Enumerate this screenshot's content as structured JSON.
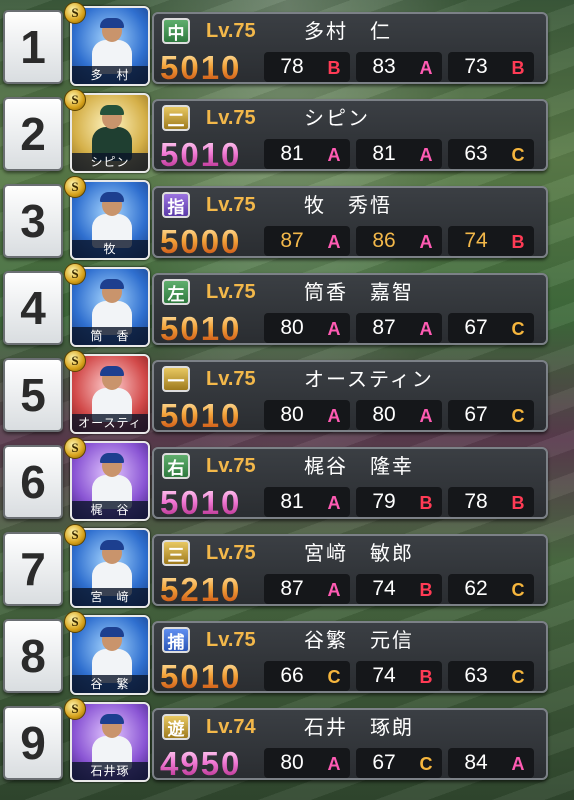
{
  "players": [
    {
      "rank": "1",
      "pos": "中",
      "pos_color": "green",
      "lv": "Lv.75",
      "name": "多村　仁",
      "card_name": "多　村",
      "card_color": "blue",
      "badge": "S",
      "power": "5010",
      "power_style": "orange",
      "stats": [
        {
          "v": "78",
          "g": "B",
          "hi": false
        },
        {
          "v": "83",
          "g": "A",
          "hi": false
        },
        {
          "v": "73",
          "g": "B",
          "hi": false
        }
      ]
    },
    {
      "rank": "2",
      "pos": "二",
      "pos_color": "gold",
      "lv": "Lv.75",
      "name": "シピン",
      "card_name": "シピン",
      "card_color": "gold",
      "badge": "S",
      "power": "5010",
      "power_style": "pink",
      "stats": [
        {
          "v": "81",
          "g": "A",
          "hi": false
        },
        {
          "v": "81",
          "g": "A",
          "hi": false
        },
        {
          "v": "63",
          "g": "C",
          "hi": false
        }
      ]
    },
    {
      "rank": "3",
      "pos": "指",
      "pos_color": "purple",
      "lv": "Lv.75",
      "name": "牧　秀悟",
      "card_name": "牧",
      "card_color": "blue",
      "badge": "S",
      "power": "5000",
      "power_style": "orange",
      "stats": [
        {
          "v": "87",
          "g": "A",
          "hi": true
        },
        {
          "v": "86",
          "g": "A",
          "hi": true
        },
        {
          "v": "74",
          "g": "B",
          "hi": true
        }
      ]
    },
    {
      "rank": "4",
      "pos": "左",
      "pos_color": "green",
      "lv": "Lv.75",
      "name": "筒香　嘉智",
      "card_name": "筒　香",
      "card_color": "blue",
      "badge": "S",
      "power": "5010",
      "power_style": "orange",
      "stats": [
        {
          "v": "80",
          "g": "A",
          "hi": false
        },
        {
          "v": "87",
          "g": "A",
          "hi": false
        },
        {
          "v": "67",
          "g": "C",
          "hi": false
        }
      ]
    },
    {
      "rank": "5",
      "pos": "一",
      "pos_color": "gold",
      "lv": "Lv.75",
      "name": "オースティン",
      "card_name": "オースティン",
      "card_color": "red",
      "badge": "S",
      "power": "5010",
      "power_style": "orange",
      "stats": [
        {
          "v": "80",
          "g": "A",
          "hi": false
        },
        {
          "v": "80",
          "g": "A",
          "hi": false
        },
        {
          "v": "67",
          "g": "C",
          "hi": false
        }
      ]
    },
    {
      "rank": "6",
      "pos": "右",
      "pos_color": "green",
      "lv": "Lv.75",
      "name": "梶谷　隆幸",
      "card_name": "梶　谷",
      "card_color": "purple",
      "badge": "S",
      "power": "5010",
      "power_style": "pink",
      "stats": [
        {
          "v": "81",
          "g": "A",
          "hi": false
        },
        {
          "v": "79",
          "g": "B",
          "hi": false
        },
        {
          "v": "78",
          "g": "B",
          "hi": false
        }
      ]
    },
    {
      "rank": "7",
      "pos": "三",
      "pos_color": "gold",
      "lv": "Lv.75",
      "name": "宮﨑　敏郎",
      "card_name": "宮　﨑",
      "card_color": "blue",
      "badge": "S",
      "power": "5210",
      "power_style": "orange",
      "stats": [
        {
          "v": "87",
          "g": "A",
          "hi": false
        },
        {
          "v": "74",
          "g": "B",
          "hi": false
        },
        {
          "v": "62",
          "g": "C",
          "hi": false
        }
      ]
    },
    {
      "rank": "8",
      "pos": "捕",
      "pos_color": "blue",
      "lv": "Lv.75",
      "name": "谷繁　元信",
      "card_name": "谷　繁",
      "card_color": "blue",
      "badge": "S",
      "power": "5010",
      "power_style": "orange",
      "stats": [
        {
          "v": "66",
          "g": "C",
          "hi": false
        },
        {
          "v": "74",
          "g": "B",
          "hi": false
        },
        {
          "v": "63",
          "g": "C",
          "hi": false
        }
      ]
    },
    {
      "rank": "9",
      "pos": "遊",
      "pos_color": "gold",
      "lv": "Lv.74",
      "name": "石井　琢朗",
      "card_name": "石井琢",
      "card_color": "purple",
      "badge": "S",
      "power": "4950",
      "power_style": "pink",
      "stats": [
        {
          "v": "80",
          "g": "A",
          "hi": false
        },
        {
          "v": "67",
          "g": "C",
          "hi": false
        },
        {
          "v": "84",
          "g": "A",
          "hi": false
        }
      ]
    }
  ]
}
